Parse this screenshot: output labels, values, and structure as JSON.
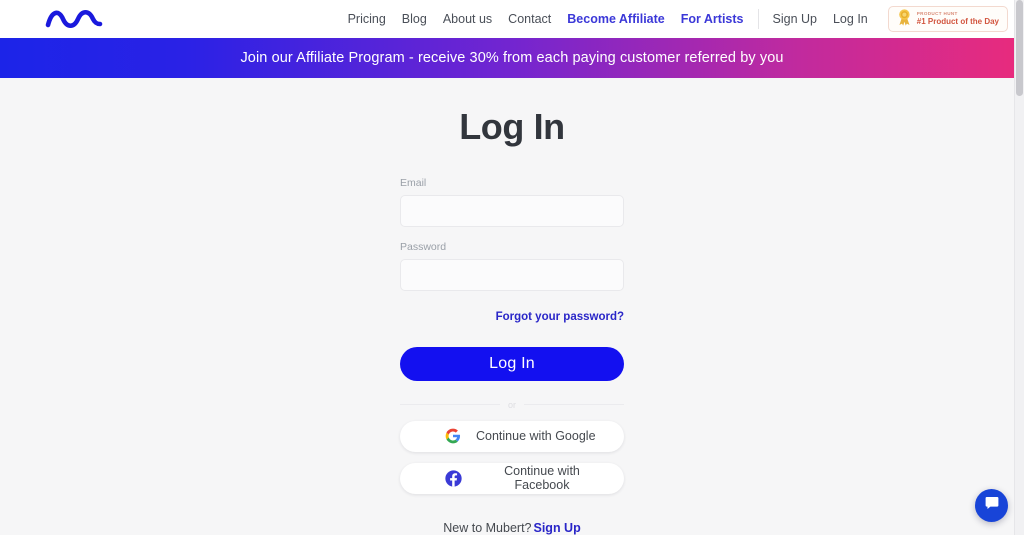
{
  "header": {
    "logo": "mubert-wave-logo",
    "nav_links": [
      {
        "label": "Pricing",
        "accent": false
      },
      {
        "label": "Blog",
        "accent": false
      },
      {
        "label": "About us",
        "accent": false
      },
      {
        "label": "Contact",
        "accent": false
      },
      {
        "label": "Become Affiliate",
        "accent": true
      },
      {
        "label": "For Artists",
        "accent": true
      }
    ],
    "auth_links": [
      {
        "label": "Sign Up"
      },
      {
        "label": "Log In"
      }
    ],
    "product_hunt_badge": {
      "top_label": "PRODUCT HUNT",
      "main_label": "#1 Product of the Day",
      "icon": "medal-icon"
    }
  },
  "banner": {
    "text": "Join our Affiliate Program - receive 30% from each paying customer referred by you",
    "gradient_start": "#1c24e8",
    "gradient_end": "#e92b7c"
  },
  "login": {
    "title": "Log In",
    "email": {
      "label": "Email",
      "value": "",
      "placeholder": ""
    },
    "password": {
      "label": "Password",
      "value": "",
      "placeholder": ""
    },
    "forgot_password": "Forgot your password?",
    "submit_label": "Log In",
    "submit_color": "#1310f0",
    "divider_text": "or",
    "social": [
      {
        "label": "Continue with Google",
        "icon": "google-icon"
      },
      {
        "label": "Continue with Facebook",
        "icon": "facebook-icon"
      }
    ],
    "signup_prompt": "New to Mubert?",
    "signup_link": "Sign Up"
  },
  "widgets": {
    "chat_icon": "chat-bubble-icon",
    "chat_color": "#1844d8"
  }
}
